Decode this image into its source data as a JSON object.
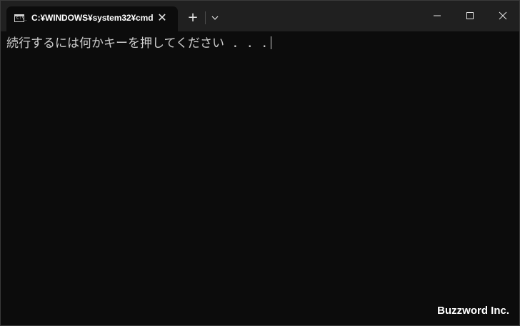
{
  "tab": {
    "title": "C:¥WINDOWS¥system32¥cmd",
    "icon_prompt": "C:\\_",
    "close_glyph": "✕"
  },
  "toolbar": {
    "new_tab_glyph": "+"
  },
  "console": {
    "line1": "続行するには何かキーを押してください . . ."
  },
  "watermark": {
    "text": "Buzzword Inc."
  },
  "icons": {
    "tab": "cmd-icon",
    "dropdown": "chevron-down-icon",
    "minimize": "minimize-icon",
    "maximize": "maximize-icon",
    "close": "close-icon"
  },
  "colors": {
    "titlebar": "#202020",
    "console_bg": "#0c0c0c",
    "console_text": "#cccccc"
  }
}
